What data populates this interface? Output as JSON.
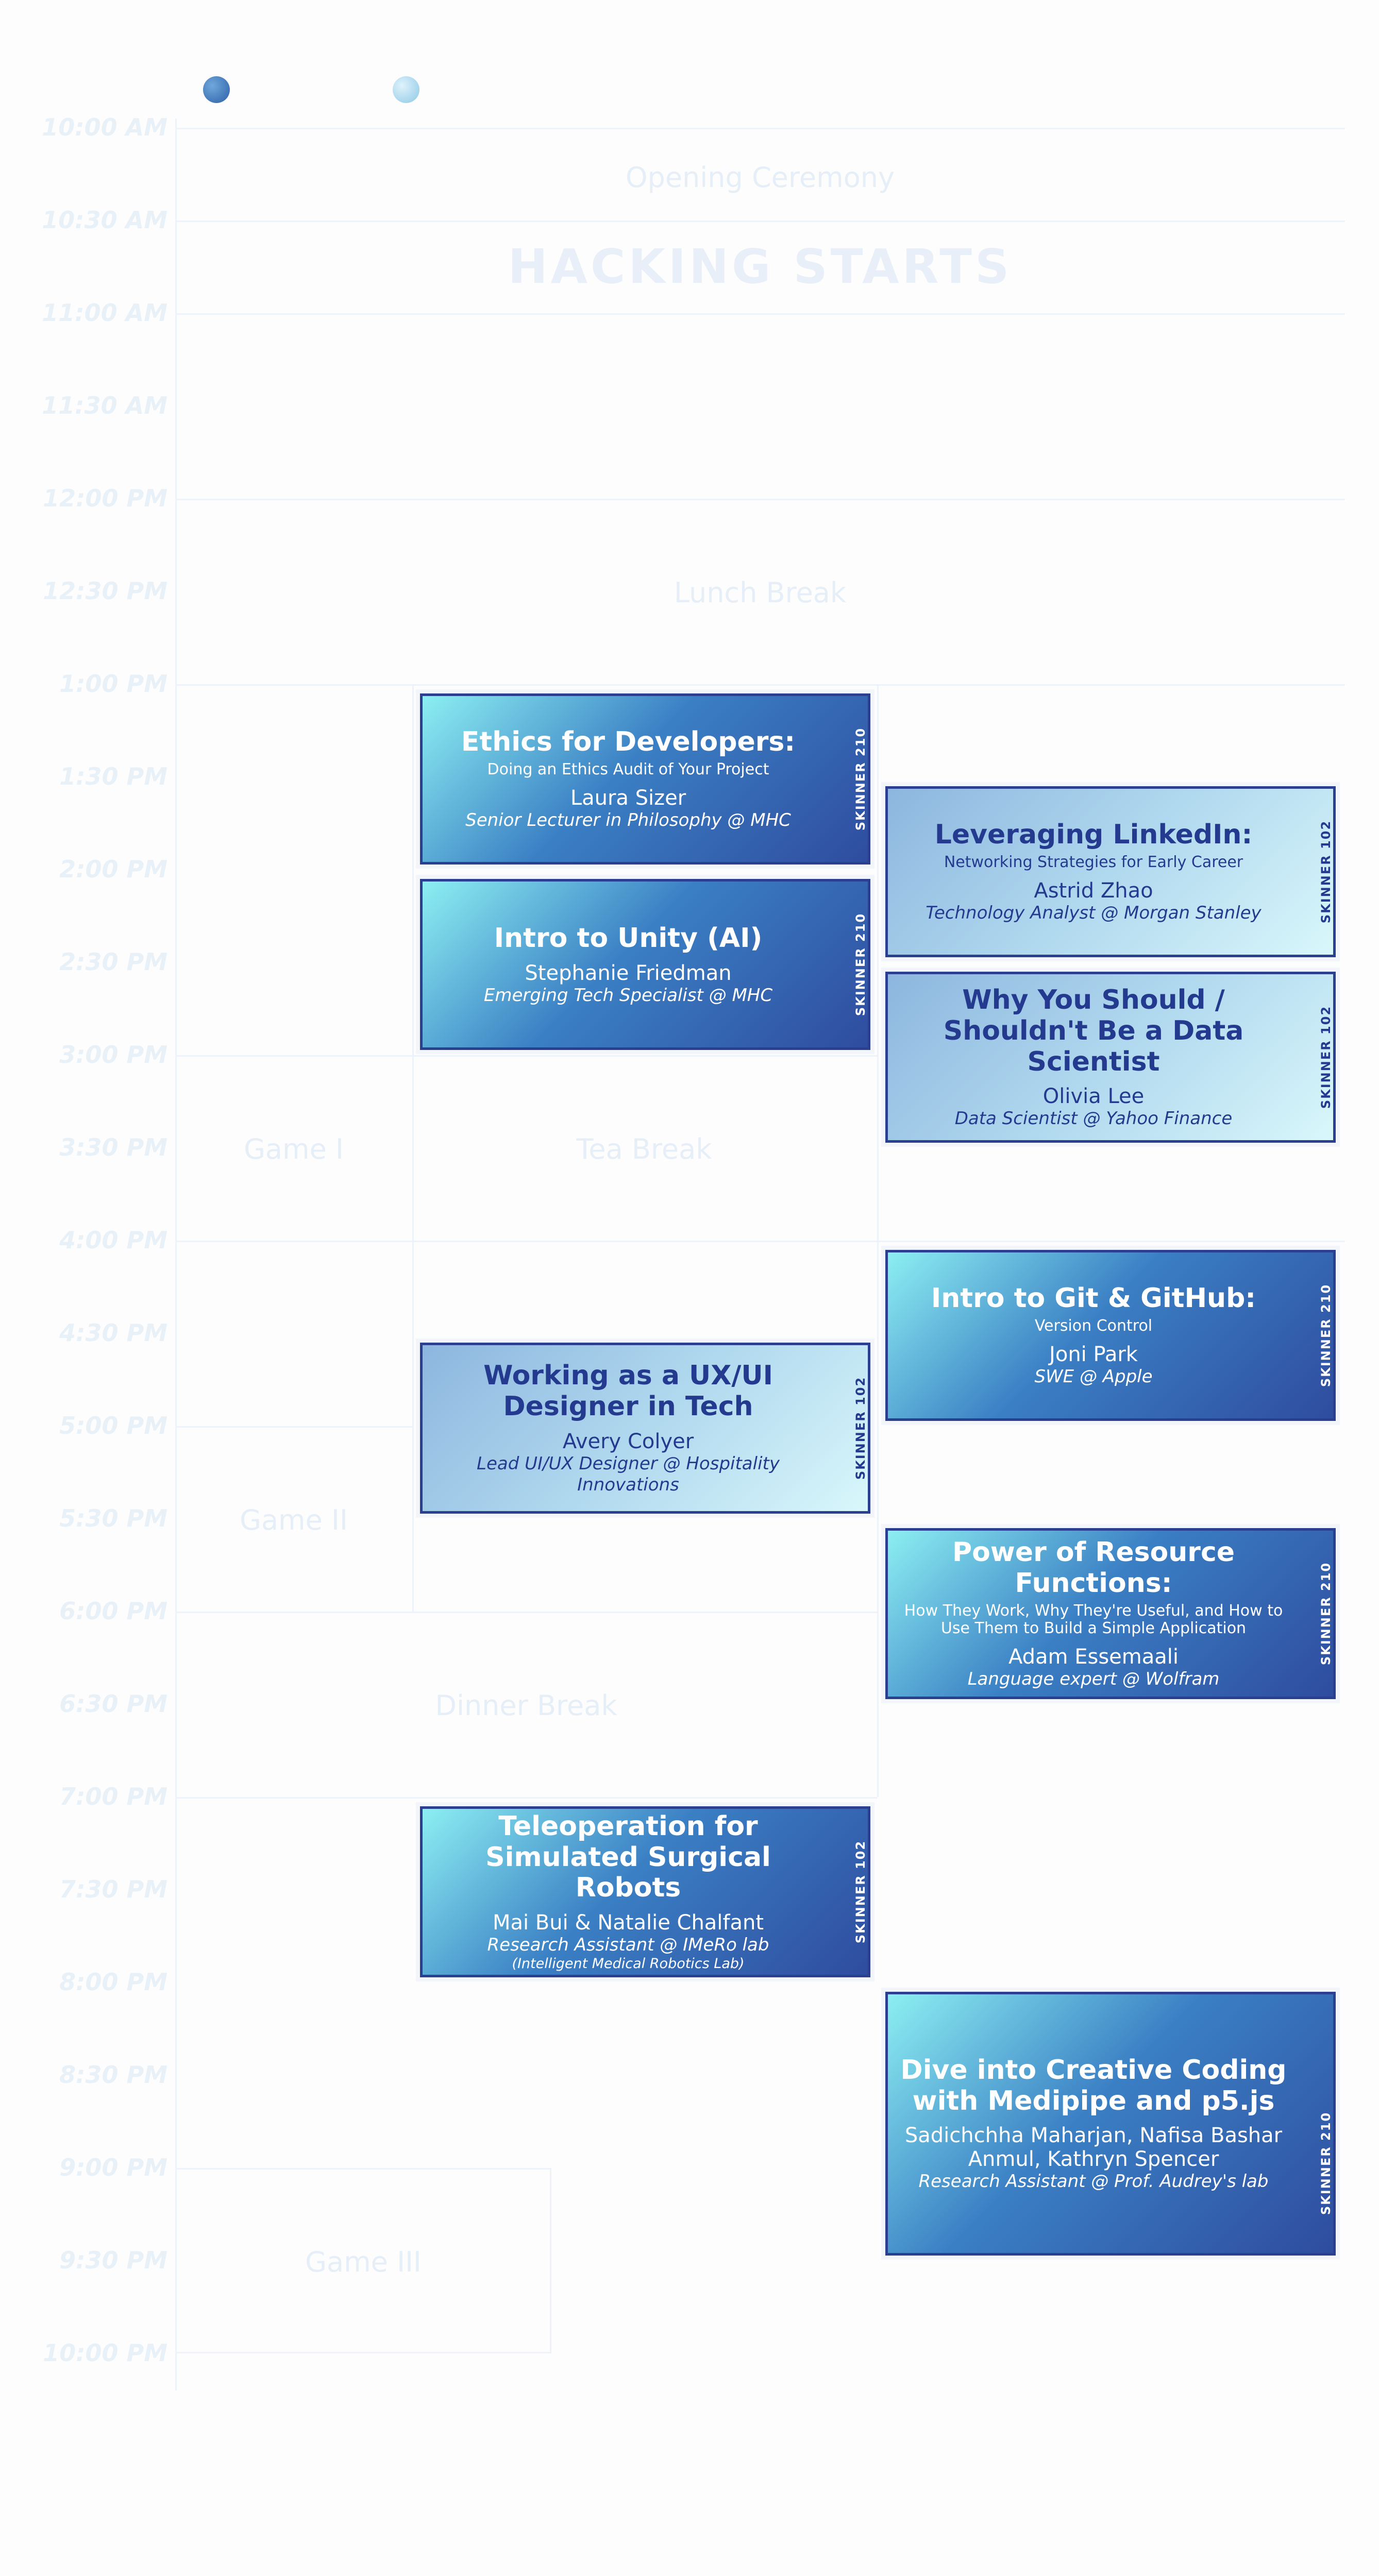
{
  "times": [
    "10:00 AM",
    "10:30 AM",
    "11:00 AM",
    "11:30 AM",
    "12:00 PM",
    "12:30 PM",
    "1:00 PM",
    "1:30 PM",
    "2:00 PM",
    "2:30 PM",
    "3:00 PM",
    "3:30 PM",
    "4:00 PM",
    "4:30 PM",
    "5:00 PM",
    "5:30 PM",
    "6:00 PM",
    "6:30 PM",
    "7:00 PM",
    "7:30 PM",
    "8:00 PM",
    "8:30 PM",
    "9:00 PM",
    "9:30 PM",
    "10:00 PM"
  ],
  "blocks": {
    "opening": "Opening Ceremony",
    "hacking": "HACKING STARTS",
    "lunch": "Lunch Break",
    "game1": "Game I",
    "tea": "Tea Break",
    "game2": "Game II",
    "dinner": "Dinner Break",
    "game3": "Game III"
  },
  "sessions": [
    {
      "title": "Ethics for Developers:",
      "subtitle": "Doing an Ethics Audit of Your Project",
      "speaker": "Laura Sizer",
      "role": "Senior Lecturer in Philosophy @ MHC",
      "room": "SKINNER 210"
    },
    {
      "title": "Leveraging LinkedIn:",
      "subtitle": "Networking Strategies for Early Career",
      "speaker": "Astrid Zhao",
      "role": "Technology Analyst @ Morgan Stanley",
      "room": "SKINNER 102"
    },
    {
      "title": "Intro to Unity (AI)",
      "speaker": "Stephanie Friedman",
      "role": "Emerging Tech Specialist @ MHC",
      "room": "SKINNER 210"
    },
    {
      "title": "Why You Should / Shouldn't Be a Data Scientist",
      "speaker": "Olivia Lee",
      "role": "Data Scientist @ Yahoo Finance",
      "room": "SKINNER 102"
    },
    {
      "title": "Intro to Git & GitHub:",
      "subtitle": "Version Control",
      "speaker": "Joni Park",
      "role": "SWE @ Apple",
      "room": "SKINNER 210"
    },
    {
      "title": "Working as a UX/UI Designer in Tech",
      "speaker": "Avery Colyer",
      "role": "Lead UI/UX Designer @ Hospitality Innovations",
      "room": "SKINNER 102"
    },
    {
      "title": "Power of Resource Functions:",
      "subtitle": "How They Work, Why They're Useful, and How to Use Them to Build a Simple Application",
      "speaker": "Adam Essemaali",
      "role": "Language expert @ Wolfram",
      "room": "SKINNER 210"
    },
    {
      "title": "Teleoperation for Simulated Surgical Robots",
      "speaker": "Mai Bui & Natalie Chalfant",
      "role": "Research Assistant @ IMeRo lab",
      "role2": "(Intelligent Medical Robotics Lab)",
      "room": "SKINNER 102"
    },
    {
      "title": "Dive into Creative Coding with Medipipe and p5.js",
      "speaker": "Sadichchha Maharjan, Nafisa Bashar Anmul, Kathryn Spencer",
      "role": "Research Assistant @ Prof. Audrey's lab",
      "room": "SKINNER 210"
    }
  ]
}
